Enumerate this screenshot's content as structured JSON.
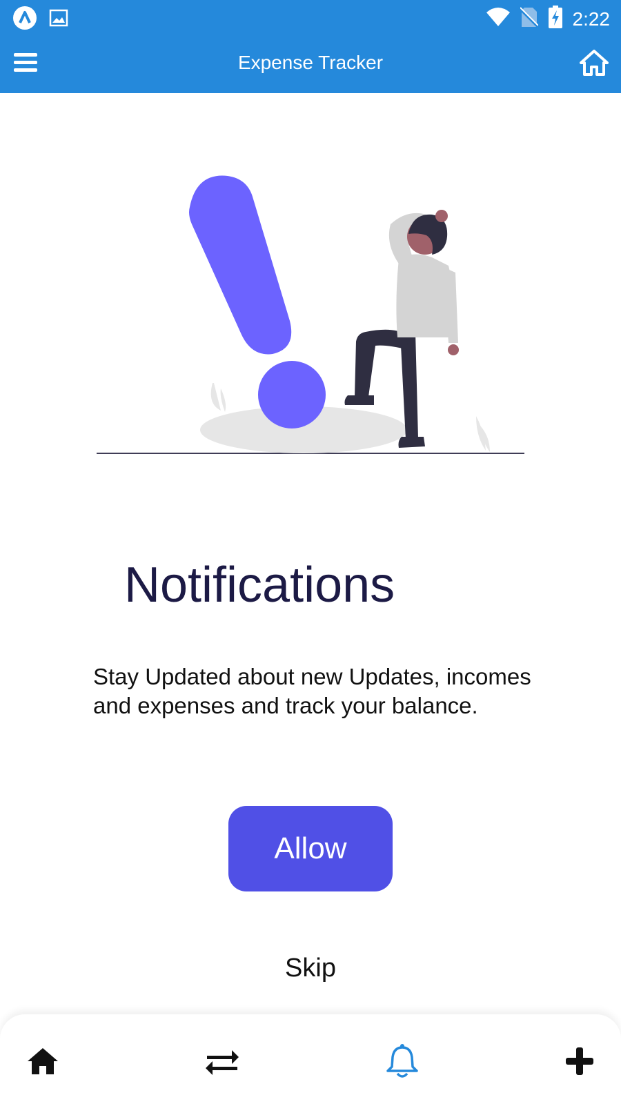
{
  "status_bar": {
    "time": "2:22",
    "left_icons": [
      "app-icon",
      "image-icon"
    ],
    "right_icons": [
      "wifi-icon",
      "no-sim-icon",
      "battery-charging-icon"
    ]
  },
  "app_bar": {
    "title": "Expense Tracker",
    "menu_icon": "hamburger-menu-icon",
    "home_icon": "home-icon",
    "background": "#2589db"
  },
  "onboarding": {
    "illustration": "notification-alert-illustration",
    "heading": "Notifications",
    "description": "Stay Updated about new Updates, incomes and expenses and track your balance.",
    "allow_label": "Allow",
    "skip_label": "Skip",
    "accent": "#5050e6",
    "illustration_accent": "#6c63ff"
  },
  "bottom_nav": {
    "items": [
      {
        "icon": "home-icon",
        "active": false
      },
      {
        "icon": "transfer-arrows-icon",
        "active": false
      },
      {
        "icon": "bell-icon",
        "active": true
      },
      {
        "icon": "plus-icon",
        "active": false
      }
    ],
    "active_color": "#2589db"
  }
}
